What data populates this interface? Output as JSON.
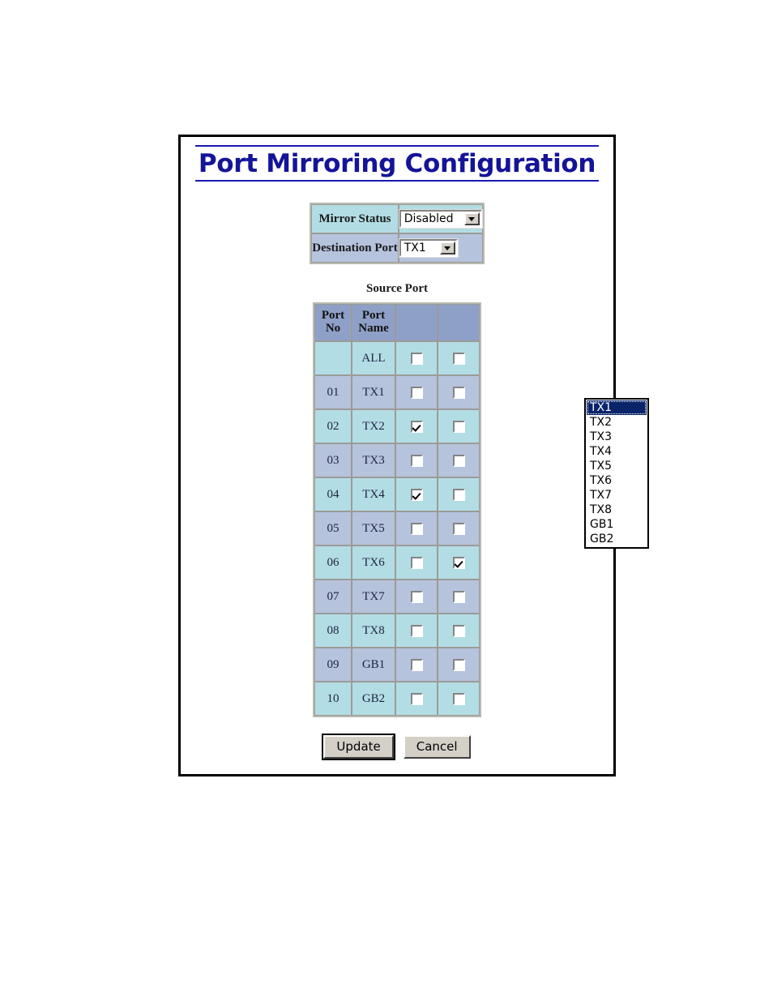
{
  "page": {
    "title": "Port Mirroring Configuration"
  },
  "settings": {
    "mirror_status": {
      "label": "Mirror Status",
      "value": "Disabled"
    },
    "destination_port": {
      "label": "Destination Port",
      "value": "TX1",
      "dropdown_open": true,
      "options": [
        "TX1",
        "TX2",
        "TX3",
        "TX4",
        "TX5",
        "TX6",
        "TX7",
        "TX8",
        "GB1",
        "GB2"
      ],
      "selected_option": "TX1"
    }
  },
  "source_ports": {
    "caption": "Source Port",
    "headers": {
      "port_no": "Port No",
      "port_name": "Port Name",
      "col3": "",
      "col4": ""
    },
    "rows": [
      {
        "no": "",
        "name": "ALL",
        "cb3": false,
        "cb4": false
      },
      {
        "no": "01",
        "name": "TX1",
        "cb3": false,
        "cb4": false
      },
      {
        "no": "02",
        "name": "TX2",
        "cb3": true,
        "cb4": false
      },
      {
        "no": "03",
        "name": "TX3",
        "cb3": false,
        "cb4": false
      },
      {
        "no": "04",
        "name": "TX4",
        "cb3": true,
        "cb4": false
      },
      {
        "no": "05",
        "name": "TX5",
        "cb3": false,
        "cb4": false
      },
      {
        "no": "06",
        "name": "TX6",
        "cb3": false,
        "cb4": true
      },
      {
        "no": "07",
        "name": "TX7",
        "cb3": false,
        "cb4": false
      },
      {
        "no": "08",
        "name": "TX8",
        "cb3": false,
        "cb4": false
      },
      {
        "no": "09",
        "name": "GB1",
        "cb3": false,
        "cb4": false
      },
      {
        "no": "10",
        "name": "GB2",
        "cb3": false,
        "cb4": false
      }
    ]
  },
  "buttons": {
    "update": "Update",
    "cancel": "Cancel"
  },
  "colors": {
    "title": "#141499",
    "header_row": "#8fa0c8",
    "row_cyan": "#b3dde5",
    "row_blue": "#b6c3dd",
    "highlight": "#0a246a",
    "border": "#000000"
  }
}
